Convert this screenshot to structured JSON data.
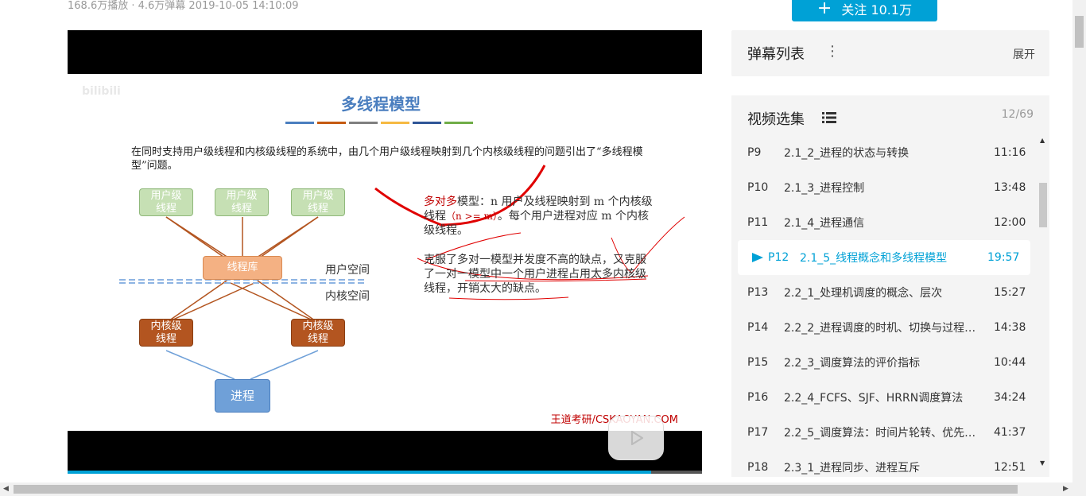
{
  "video": {
    "stats": "168.6万播放 · 4.6万弹幕    2019-10-05 14:10:09",
    "follow_label": "关注 10.1万",
    "progress_fraction": 0.92
  },
  "slide": {
    "title": "多线程模型",
    "intro": "在同时支持用户级线程和内核级线程的系统中，由几个用户级线程映射到几个内核级线程的问题引出了“多线程模型”问题。",
    "user_thread_label": "用户级\n线程",
    "kernel_thread_label": "内核级\n线程",
    "lib_label": "线程库",
    "process_label": "进程",
    "user_space_label": "用户空间",
    "kernel_space_label": "内核空间",
    "model_name": "多对多",
    "model_desc_1": "模型：n 用户及线程映射到 m 个内核级线程",
    "model_cond": "（n >= m）",
    "model_desc_2": "。每个用户进程对应 m 个内核级线程。",
    "advantage": "克服了多对一模型并发度不高的缺点，又克服了一对一模型中一个用户进程占用太多内核级线程，开销太大的缺点。",
    "footer": "王道考研/CSKAOYAN.COM",
    "watermark": "bilibili",
    "color_bars": [
      "#4a7ebf",
      "#c55a11",
      "#7f7f7f",
      "#f5b942",
      "#2f5597",
      "#70ad47"
    ]
  },
  "danmaku": {
    "title": "弹幕列表",
    "expand_label": "展开"
  },
  "playlist": {
    "title": "视频选集",
    "count": "12/69",
    "items": [
      {
        "p": "P9",
        "title": "2.1_2_进程的状态与转换",
        "duration": "11:16"
      },
      {
        "p": "P10",
        "title": "2.1_3_进程控制",
        "duration": "13:48"
      },
      {
        "p": "P11",
        "title": "2.1_4_进程通信",
        "duration": "12:00"
      },
      {
        "p": "P12",
        "title": "2.1_5_线程概念和多线程模型",
        "duration": "19:57"
      },
      {
        "p": "P13",
        "title": "2.2_1_处理机调度的概念、层次",
        "duration": "15:27"
      },
      {
        "p": "P14",
        "title": "2.2_2_进程调度的时机、切换与过程…",
        "duration": "14:38"
      },
      {
        "p": "P15",
        "title": "2.2_3_调度算法的评价指标",
        "duration": "10:44"
      },
      {
        "p": "P16",
        "title": "2.2_4_FCFS、SJF、HRRN调度算法",
        "duration": "34:24"
      },
      {
        "p": "P17",
        "title": "2.2_5_调度算法：时间片轮转、优先…",
        "duration": "41:37"
      },
      {
        "p": "P18",
        "title": "2.3_1_进程同步、进程互斥",
        "duration": "12:51"
      }
    ]
  }
}
